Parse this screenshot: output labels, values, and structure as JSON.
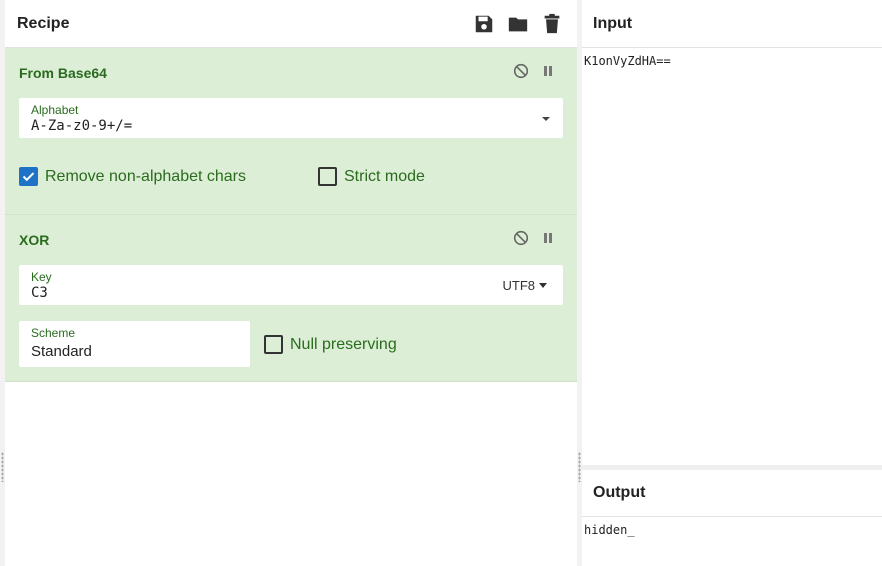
{
  "recipe": {
    "title": "Recipe",
    "icons": [
      "save-icon",
      "folder-icon",
      "trash-icon"
    ],
    "operations": [
      {
        "name": "From Base64",
        "alphabet": {
          "label": "Alphabet",
          "value": "A-Za-z0-9+/="
        },
        "remove_non_alphabet": {
          "label": "Remove non-alphabet chars",
          "checked": true
        },
        "strict_mode": {
          "label": "Strict mode",
          "checked": false
        }
      },
      {
        "name": "XOR",
        "key": {
          "label": "Key",
          "value": "C3",
          "encoding": "UTF8"
        },
        "scheme": {
          "label": "Scheme",
          "value": "Standard"
        },
        "null_preserving": {
          "label": "Null preserving",
          "checked": false
        }
      }
    ]
  },
  "input": {
    "title": "Input",
    "text": "K1onVyZdHA=="
  },
  "output": {
    "title": "Output",
    "text": "hidden_"
  },
  "colors": {
    "op_background": "#dcefd6",
    "op_text": "#2a6b1e",
    "checkbox_on": "#1f73c6"
  }
}
